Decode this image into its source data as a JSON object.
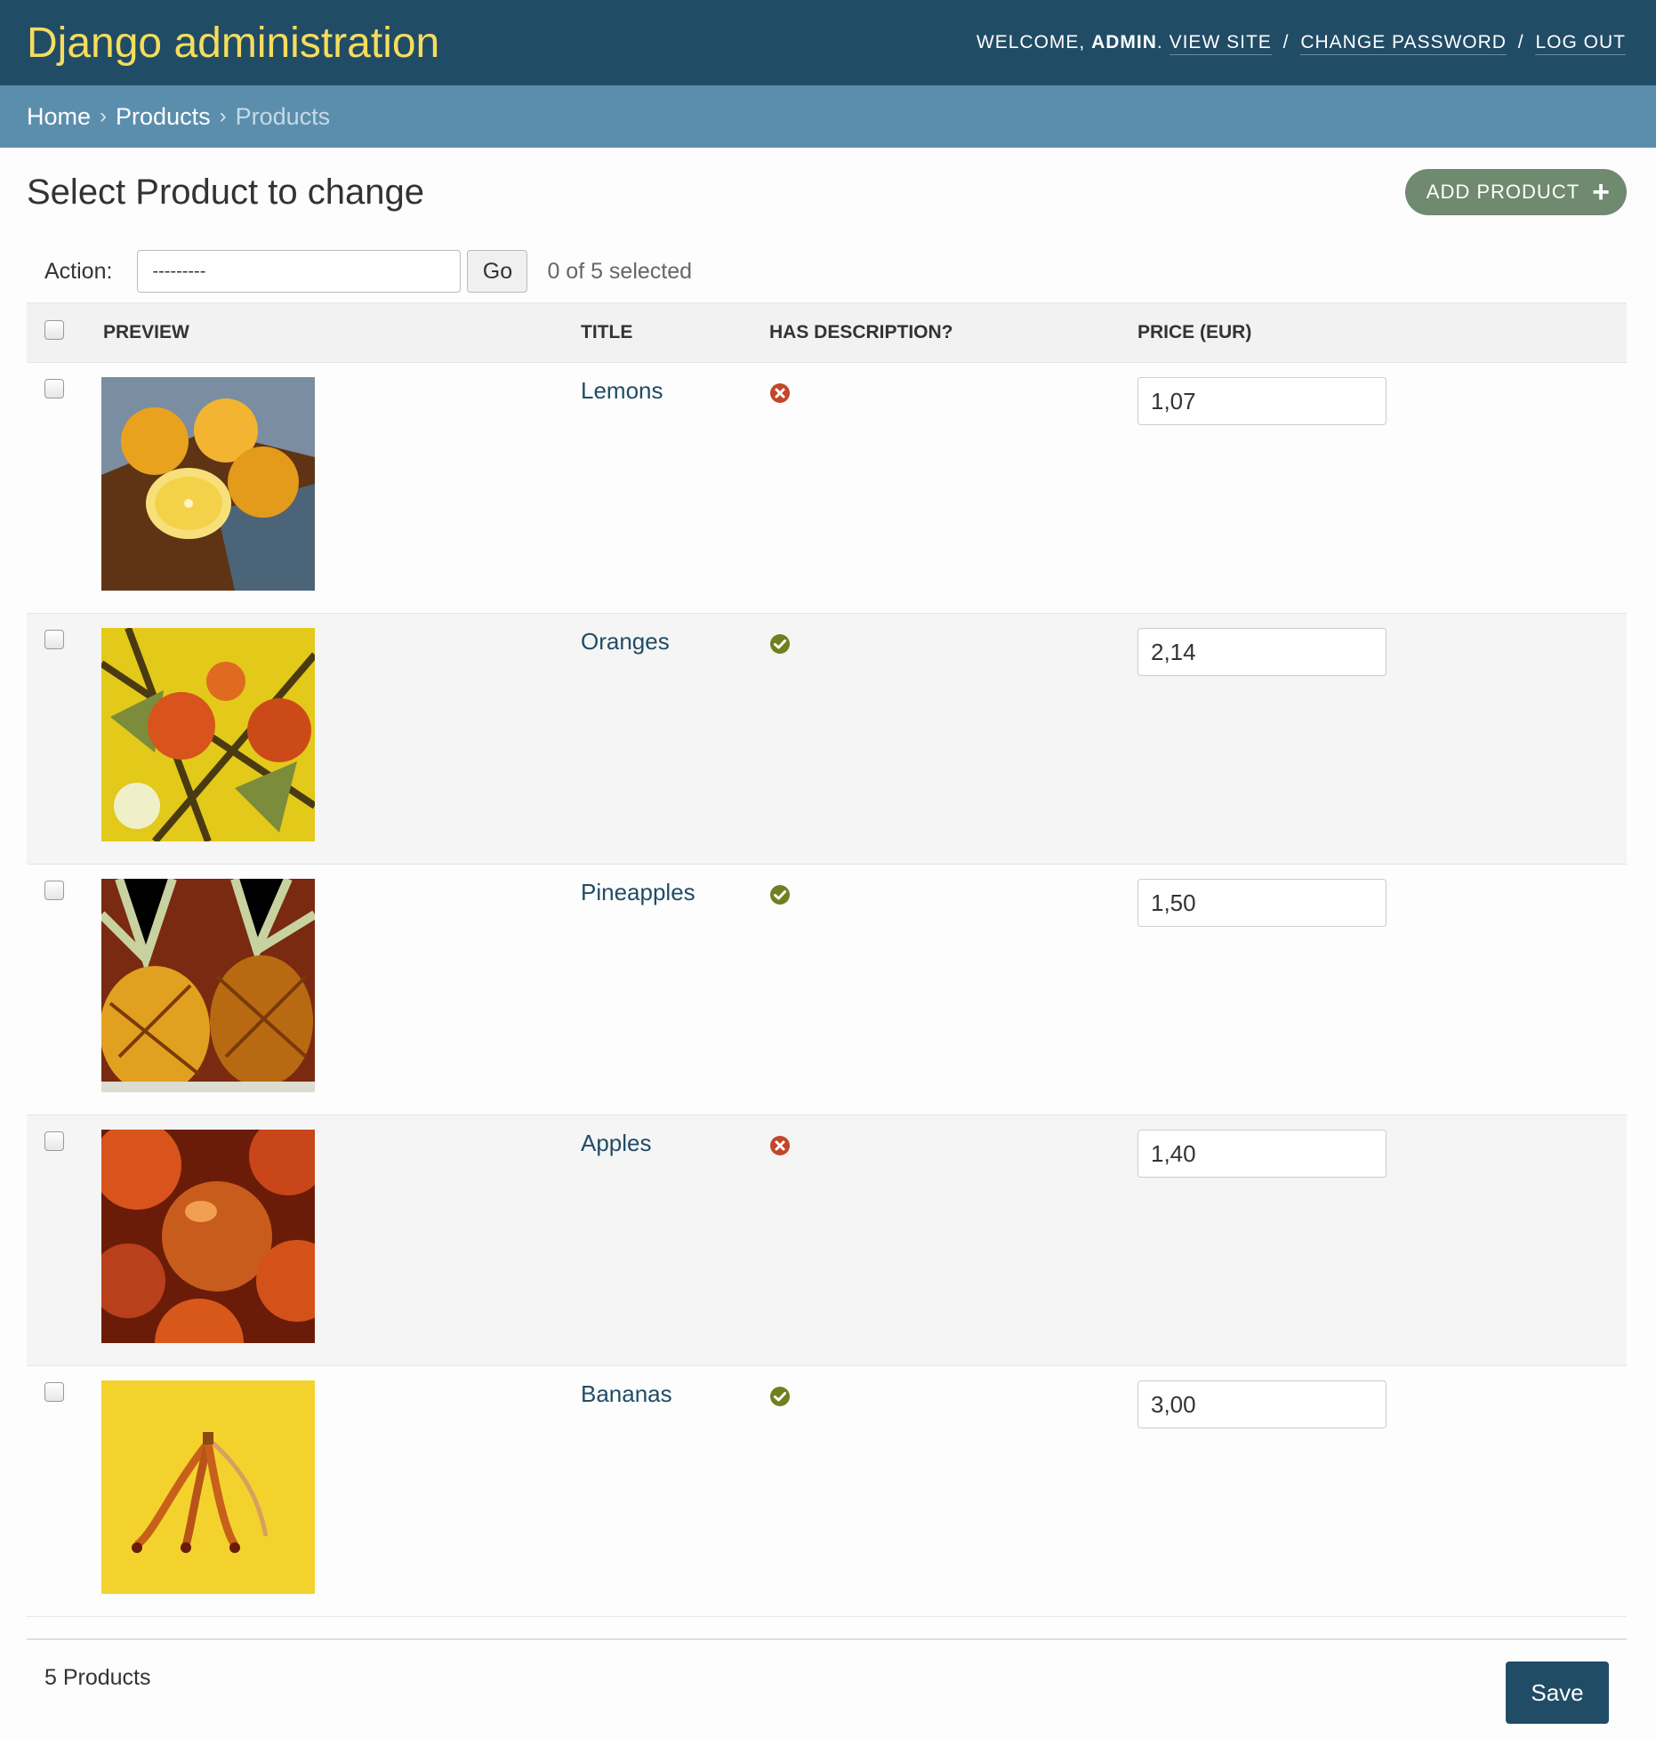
{
  "header": {
    "branding": "Django administration",
    "welcome_prefix": "WELCOME,",
    "user_name": "ADMIN",
    "welcome_suffix": ".",
    "links": [
      "VIEW SITE",
      "CHANGE PASSWORD",
      "LOG OUT"
    ],
    "separator": "/"
  },
  "breadcrumbs": {
    "home": "Home",
    "app": "Products",
    "current": "Products",
    "separator": "›"
  },
  "page": {
    "title": "Select Product to change",
    "add_button": "ADD PRODUCT"
  },
  "actions": {
    "label": "Action:",
    "selected_option": "---------",
    "go": "Go",
    "selected_count": "0 of 5 selected"
  },
  "table": {
    "headers": {
      "preview": "PREVIEW",
      "title": "TITLE",
      "has_description": "HAS DESCRIPTION?",
      "price": "PRICE (EUR)"
    },
    "rows": [
      {
        "title": "Lemons",
        "has_description": false,
        "price": "1,07",
        "preview": "lemons-image"
      },
      {
        "title": "Oranges",
        "has_description": true,
        "price": "2,14",
        "preview": "oranges-image"
      },
      {
        "title": "Pineapples",
        "has_description": true,
        "price": "1,50",
        "preview": "pineapples-image"
      },
      {
        "title": "Apples",
        "has_description": false,
        "price": "1,40",
        "preview": "apples-image"
      },
      {
        "title": "Bananas",
        "has_description": true,
        "price": "3,00",
        "preview": "bananas-image"
      }
    ]
  },
  "footer": {
    "count": "5 Products",
    "save": "Save"
  },
  "colors": {
    "header_bg": "#214c66",
    "branding": "#f5dd5d",
    "breadcrumbs_bg": "#5b8ead",
    "add_button": "#6f8a6e",
    "yes_icon": "#70801f",
    "no_icon": "#c2472a",
    "link": "#214c66"
  }
}
